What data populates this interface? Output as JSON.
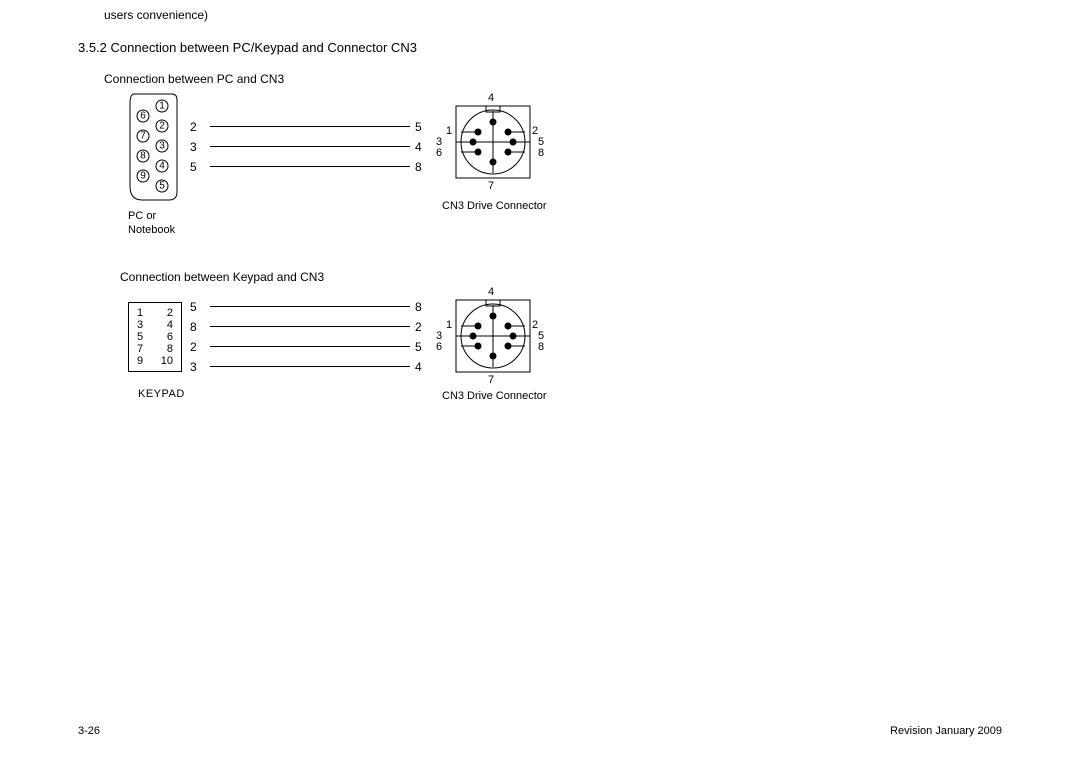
{
  "top_note": "users  convenience)",
  "heading": "3.5.2  Connection between PC/Keypad and Connector CN3",
  "sub1": "Connection between PC and CN3",
  "sub2": "Connection between Keypad and CN3",
  "db9": {
    "left_col": [
      "6",
      "7",
      "8",
      "9"
    ],
    "right_col": [
      "1",
      "2",
      "3",
      "4",
      "5"
    ],
    "label_line1": "PC or",
    "label_line2": "Notebook"
  },
  "wires1": {
    "rows": [
      {
        "l": "2",
        "r": "5"
      },
      {
        "l": "3",
        "r": "4"
      },
      {
        "l": "5",
        "r": "8"
      }
    ]
  },
  "cn3": {
    "n4": "4",
    "n1": "1",
    "n2": "2",
    "n3": "3",
    "n5": "5",
    "n6": "6",
    "n8": "8",
    "n7": "7",
    "label": "CN3 Drive Connector"
  },
  "keypad": {
    "left": [
      "1",
      "3",
      "5",
      "7",
      "9"
    ],
    "right": [
      "2",
      "4",
      "6",
      "8",
      "10"
    ],
    "label": "KEYPAD"
  },
  "wires2": {
    "rows": [
      {
        "l": "5",
        "r": "8"
      },
      {
        "l": "8",
        "r": "2"
      },
      {
        "l": "2",
        "r": "5"
      },
      {
        "l": "3",
        "r": "4"
      }
    ]
  },
  "footer": {
    "left": "3-26",
    "right": "Revision January 2009"
  }
}
